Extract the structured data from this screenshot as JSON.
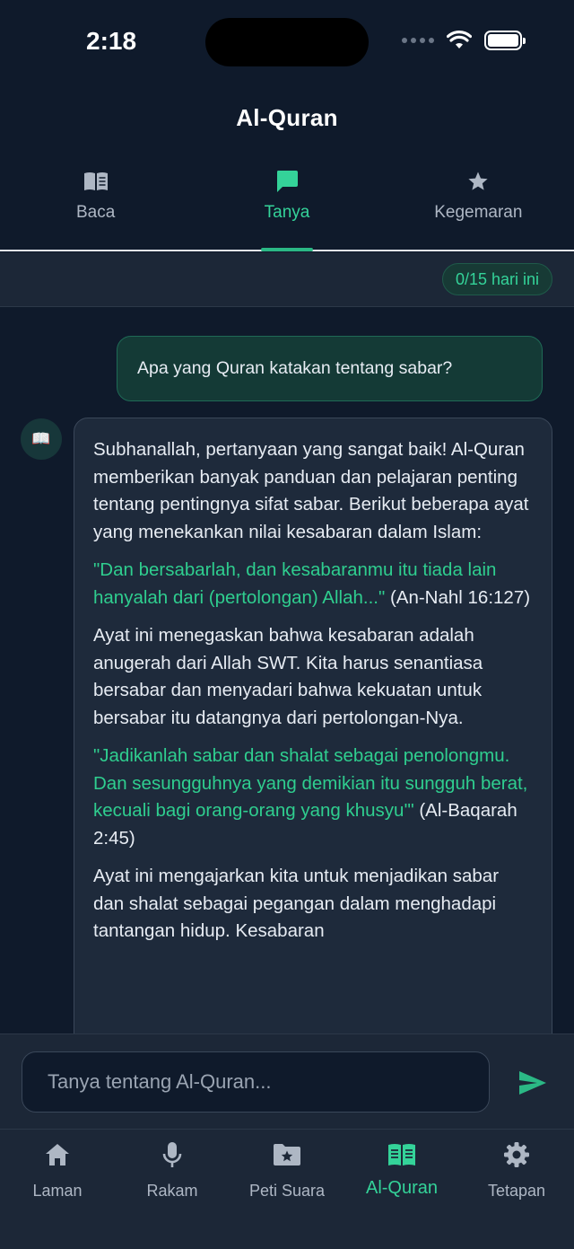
{
  "status_bar": {
    "time": "2:18"
  },
  "header": {
    "title": "Al-Quran"
  },
  "tabs": [
    {
      "label": "Baca",
      "icon": "book-open-icon",
      "active": false
    },
    {
      "label": "Tanya",
      "icon": "chat-bubble-icon",
      "active": true
    },
    {
      "label": "Kegemaran",
      "icon": "star-icon",
      "active": false
    }
  ],
  "quota": {
    "text": "0/15 hari ini"
  },
  "chat": {
    "user_message": "Apa yang Quran katakan tentang sabar?",
    "bot_avatar": "📖",
    "bot_message": {
      "intro": "Subhanallah, pertanyaan yang sangat baik! Al-Quran memberikan banyak panduan dan pelajaran penting tentang pentingnya sifat sabar. Berikut beberapa ayat yang menekankan nilai kesabaran dalam Islam:",
      "quote1": "\"Dan bersabarlah, dan kesabaranmu itu tiada lain hanyalah dari (pertolongan) Allah...\"",
      "ref1": " (An-Nahl 16:127)",
      "para2": "Ayat ini menegaskan bahwa kesabaran adalah anugerah dari Allah SWT. Kita harus senantiasa bersabar dan menyadari bahwa kekuatan untuk bersabar itu datangnya dari pertolongan-Nya.",
      "quote2": "\"Jadikanlah sabar dan shalat sebagai penolongmu. Dan sesungguhnya yang demikian itu sungguh berat, kecuali bagi orang-orang yang khusyu'\"",
      "ref2": " (Al-Baqarah 2:45)",
      "para3": "Ayat ini mengajarkan kita untuk menjadikan sabar dan shalat sebagai pegangan dalam menghadapi tantangan hidup. Kesabaran"
    }
  },
  "input": {
    "placeholder": "Tanya tentang Al-Quran..."
  },
  "bottom_nav": [
    {
      "label": "Laman",
      "icon": "home-icon",
      "active": false
    },
    {
      "label": "Rakam",
      "icon": "microphone-icon",
      "active": false
    },
    {
      "label": "Peti Suara",
      "icon": "folder-star-icon",
      "active": false
    },
    {
      "label": "Al-Quran",
      "icon": "book-open-icon",
      "active": true
    },
    {
      "label": "Tetapan",
      "icon": "gear-icon",
      "active": false
    }
  ],
  "colors": {
    "accent": "#34d399",
    "background": "#0f1a2b",
    "surface": "#1c2737"
  }
}
